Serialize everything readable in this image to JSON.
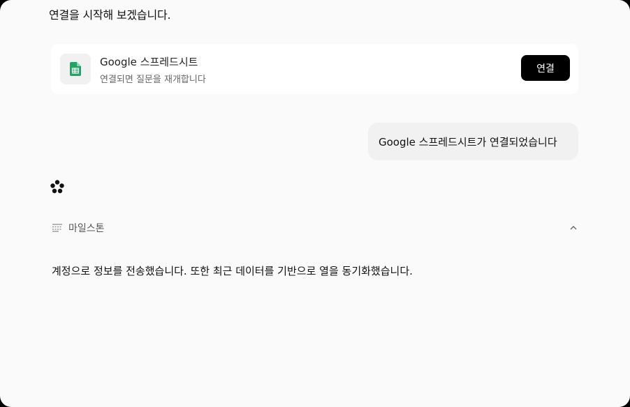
{
  "conversation": {
    "intro_message": "연결을 시작해 보겠습니다.",
    "connect_card": {
      "icon": "google-sheets-icon",
      "title": "Google 스프레드시트",
      "subtitle": "연결되면 질문을 재개합니다",
      "button_label": "연결"
    },
    "user_message": "Google 스프레드시트가 연결되었습니다",
    "milestone": {
      "icon": "milestone-lines-icon",
      "label": "마일스톤",
      "expanded": true
    },
    "assistant_result": "계정으로 정보를 전송했습니다. 또한 최근 데이터를 기반으로 열을 동기화했습니다."
  },
  "colors": {
    "sheets_green": "#1fa463",
    "button_bg": "#000000",
    "card_bg": "#ffffff",
    "bubble_bg": "#f1f1f1",
    "page_bg": "#fafafa"
  }
}
